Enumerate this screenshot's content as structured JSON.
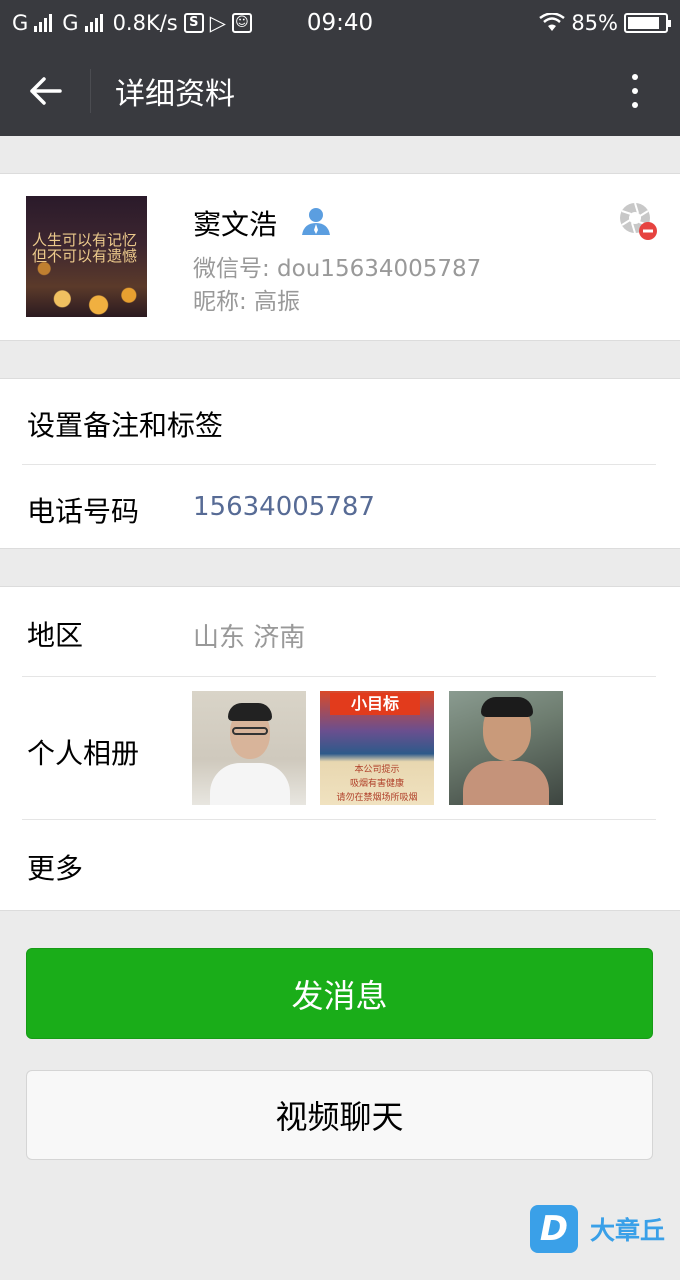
{
  "status_bar": {
    "carrier1": "G",
    "carrier2": "G",
    "speed": "0.8K/s",
    "time": "09:40",
    "battery": "85%",
    "battery_level": 0.85
  },
  "header": {
    "title": "详细资料"
  },
  "profile": {
    "name": "窦文浩",
    "wechat_id": "微信号: dou15634005787",
    "nickname": "昵称: 高振",
    "avatar_text": "人生可以有记忆\n但不可以有遗憾"
  },
  "settings": {
    "remark_label": "设置备注和标签",
    "phone_label": "电话号码",
    "phone_value": "15634005787"
  },
  "info": {
    "region_label": "地区",
    "region_value": "山东  济南",
    "album_label": "个人相册",
    "more_label": "更多",
    "album_sign_text": "小目标",
    "album_warning_text": "本公司提示\n吸烟有害健康\n请勿在禁烟场所吸烟"
  },
  "actions": {
    "send_message": "发消息",
    "video_call": "视频聊天"
  },
  "watermark": {
    "logo": "D",
    "text": "大章丘"
  },
  "colors": {
    "topbar": "#393a3f",
    "primary_green": "#1aad19",
    "phone_blue": "#576b95",
    "secondary_text": "#999999"
  }
}
